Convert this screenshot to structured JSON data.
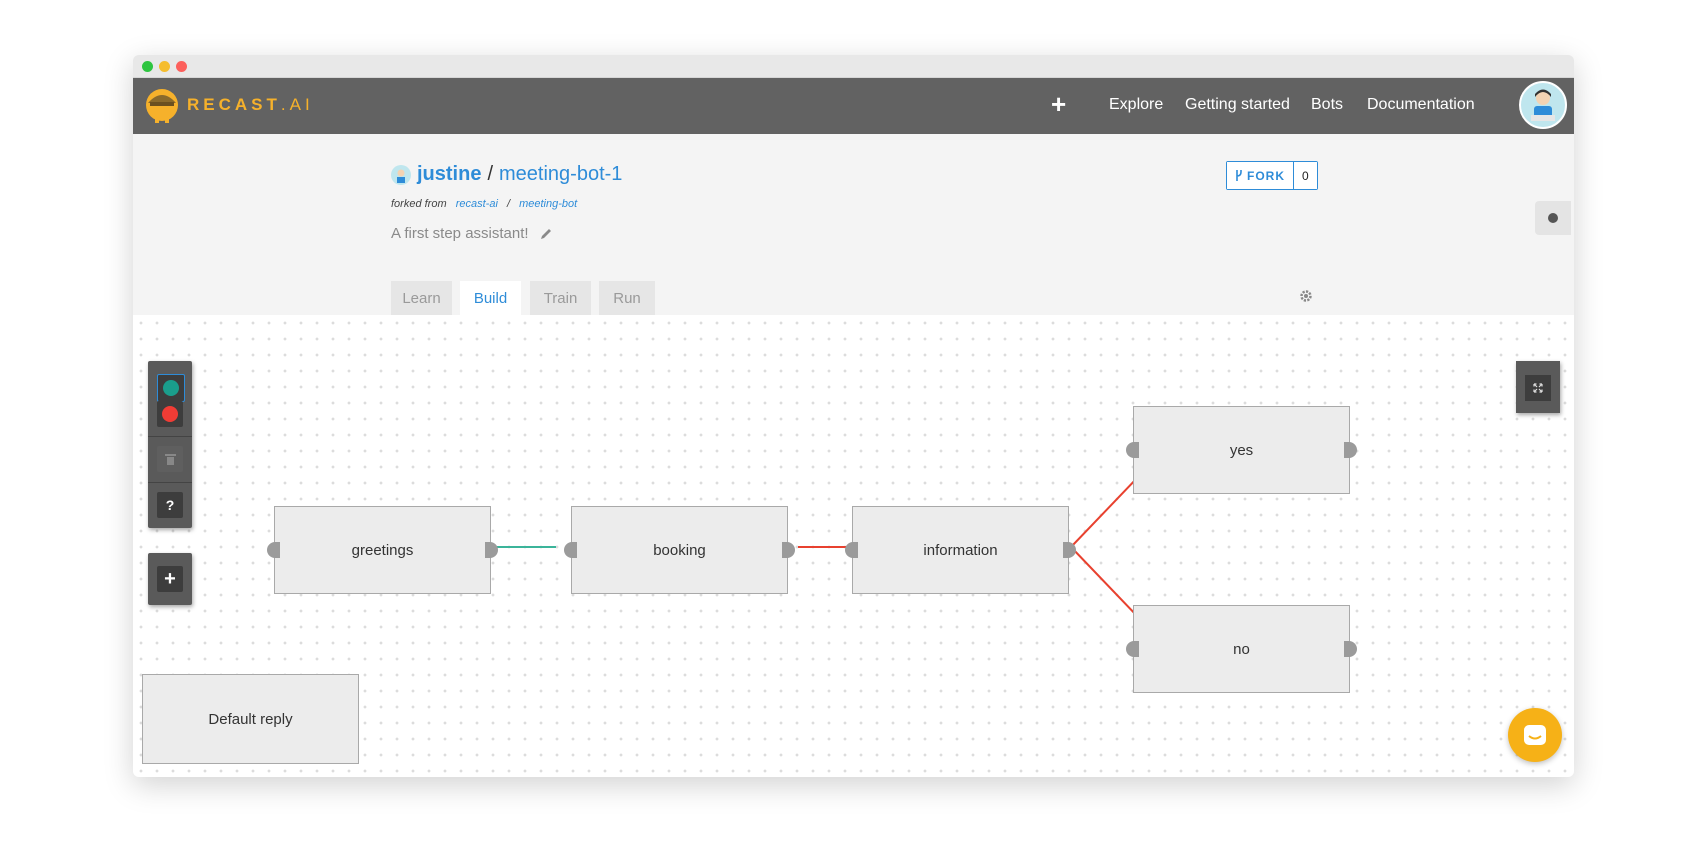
{
  "brand": {
    "name_main": "RECAST",
    "name_suffix": ".AI"
  },
  "nav": {
    "plus": "+",
    "links": [
      "Explore",
      "Getting started",
      "Bots",
      "Documentation"
    ]
  },
  "bot": {
    "owner": "justine",
    "separator": "/",
    "name": "meeting-bot-1",
    "forked_label": "forked from",
    "forked_owner": "recast-ai",
    "forked_slash": "/",
    "forked_repo": "meeting-bot",
    "description": "A first step assistant!"
  },
  "fork": {
    "label": "FORK",
    "count": "0"
  },
  "tabs": [
    {
      "label": "Learn",
      "active": false
    },
    {
      "label": "Build",
      "active": true
    },
    {
      "label": "Train",
      "active": false
    },
    {
      "label": "Run",
      "active": false
    }
  ],
  "toolbox": {
    "help": "?",
    "add": "+"
  },
  "nodes": {
    "greetings": "greetings",
    "booking": "booking",
    "information": "information",
    "yes": "yes",
    "no": "no",
    "default_reply": "Default reply"
  },
  "colors": {
    "accent": "#2e8cd8",
    "brand": "#f6b12b",
    "link_green": "#3bb49a",
    "link_red": "#e8412f",
    "start_node": "#1a9e8c",
    "end_node": "#f03c35"
  }
}
